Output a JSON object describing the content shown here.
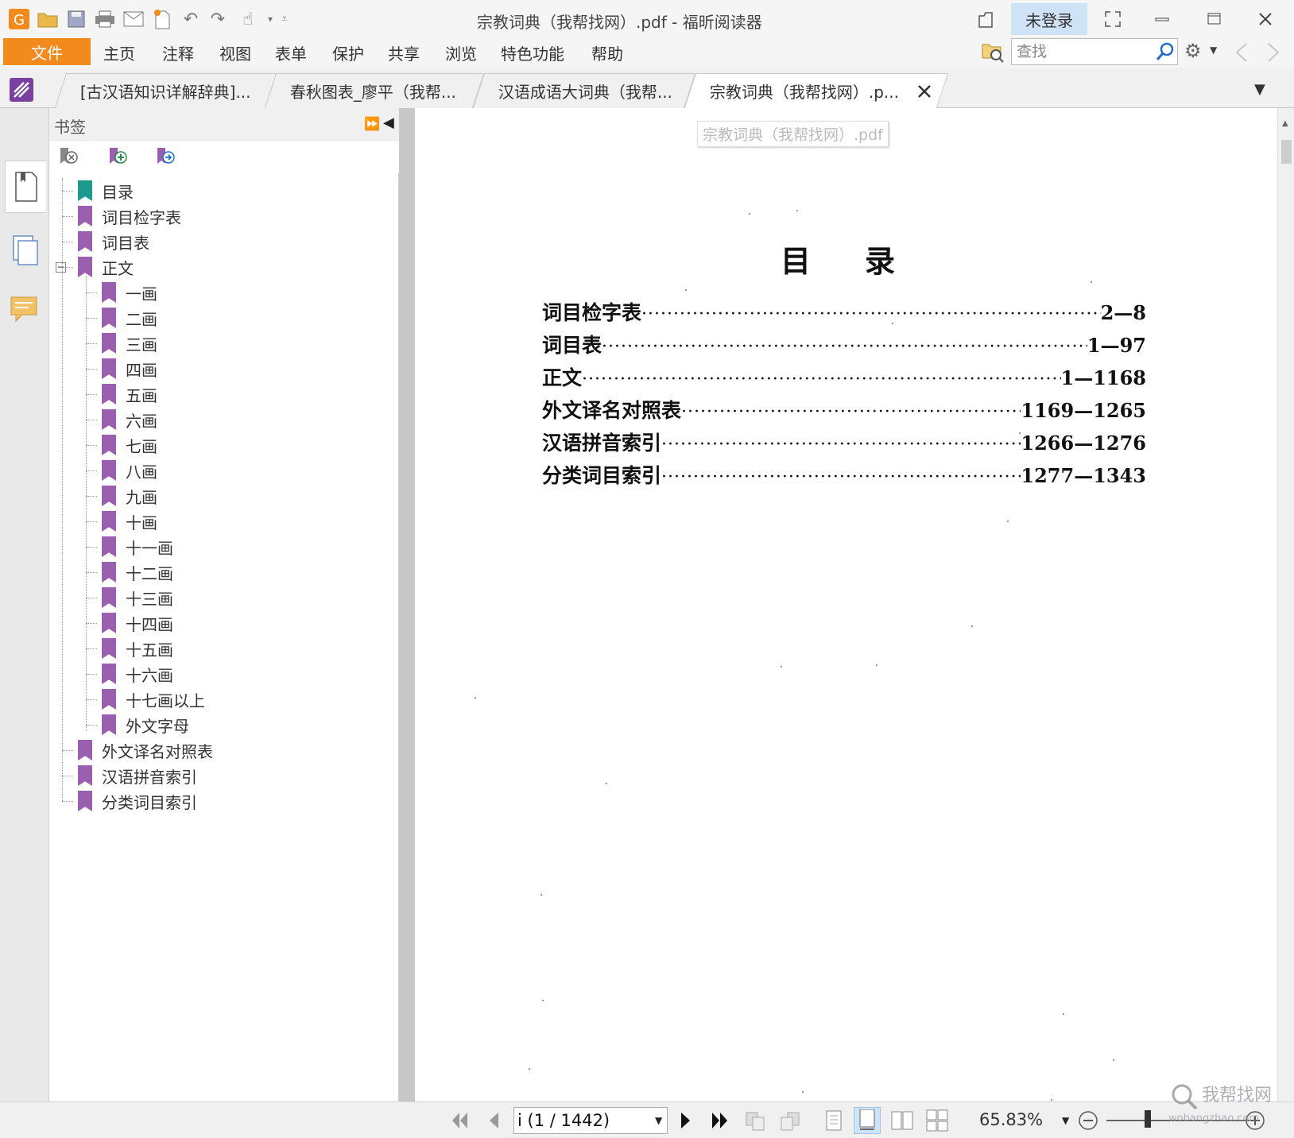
{
  "window": {
    "title": "宗教词典（我帮找网）.pdf - 福昕阅读器",
    "login_label": "未登录"
  },
  "menu": {
    "file": "文件",
    "items": [
      "主页",
      "注释",
      "视图",
      "表单",
      "保护",
      "共享",
      "浏览",
      "特色功能",
      "帮助"
    ]
  },
  "search": {
    "placeholder": "查找"
  },
  "tabs": [
    {
      "label": "[古汉语知识详解辞典]...",
      "active": false
    },
    {
      "label": "春秋图表_廖平（我帮...",
      "active": false
    },
    {
      "label": "汉语成语大词典（我帮...",
      "active": false
    },
    {
      "label": "宗教词典（我帮找网）.p...",
      "active": true
    }
  ],
  "bookmarks": {
    "panel_title": "书签",
    "items": [
      {
        "label": "目录",
        "level": 0,
        "color": "#1b9a8d"
      },
      {
        "label": "词目检字表",
        "level": 0,
        "color": "#9a5fae"
      },
      {
        "label": "词目表",
        "level": 0,
        "color": "#9a5fae"
      },
      {
        "label": "正文",
        "level": 0,
        "color": "#9a5fae",
        "expanded": true
      },
      {
        "label": "一画",
        "level": 1,
        "color": "#9a5fae"
      },
      {
        "label": "二画",
        "level": 1,
        "color": "#9a5fae"
      },
      {
        "label": "三画",
        "level": 1,
        "color": "#9a5fae"
      },
      {
        "label": "四画",
        "level": 1,
        "color": "#9a5fae"
      },
      {
        "label": "五画",
        "level": 1,
        "color": "#9a5fae"
      },
      {
        "label": "六画",
        "level": 1,
        "color": "#9a5fae"
      },
      {
        "label": "七画",
        "level": 1,
        "color": "#9a5fae"
      },
      {
        "label": "八画",
        "level": 1,
        "color": "#9a5fae"
      },
      {
        "label": "九画",
        "level": 1,
        "color": "#9a5fae"
      },
      {
        "label": "十画",
        "level": 1,
        "color": "#9a5fae"
      },
      {
        "label": "十一画",
        "level": 1,
        "color": "#9a5fae"
      },
      {
        "label": "十二画",
        "level": 1,
        "color": "#9a5fae"
      },
      {
        "label": "十三画",
        "level": 1,
        "color": "#9a5fae"
      },
      {
        "label": "十四画",
        "level": 1,
        "color": "#9a5fae"
      },
      {
        "label": "十五画",
        "level": 1,
        "color": "#9a5fae"
      },
      {
        "label": "十六画",
        "level": 1,
        "color": "#9a5fae"
      },
      {
        "label": "十七画以上",
        "level": 1,
        "color": "#9a5fae"
      },
      {
        "label": "外文字母",
        "level": 1,
        "color": "#9a5fae"
      },
      {
        "label": "外文译名对照表",
        "level": 0,
        "color": "#9a5fae"
      },
      {
        "label": "汉语拼音索引",
        "level": 0,
        "color": "#9a5fae"
      },
      {
        "label": "分类词目索引",
        "level": 0,
        "color": "#9a5fae"
      }
    ]
  },
  "document": {
    "file_label": "宗教词典（我帮找网）.pdf",
    "heading": "目录",
    "toc": [
      {
        "title": "词目检字表",
        "pages": "2—8"
      },
      {
        "title": "词目表",
        "pages": "1—97"
      },
      {
        "title": "正文",
        "pages": "1—1168"
      },
      {
        "title": "外文译名对照表",
        "pages": "1169—1265"
      },
      {
        "title": "汉语拼音索引",
        "pages": "1266—1276"
      },
      {
        "title": "分类词目索引",
        "pages": "1277—1343"
      }
    ]
  },
  "status": {
    "page_indicator": "i (1 / 1442)",
    "zoom": "65.83%"
  },
  "watermark": {
    "text": "我帮找网",
    "sub": "wobangzhao.com"
  },
  "colors": {
    "accent": "#f38a1d",
    "login_bg": "#cfe3f7",
    "bookmark_teal": "#1b9a8d",
    "bookmark_purple": "#9a5fae"
  }
}
